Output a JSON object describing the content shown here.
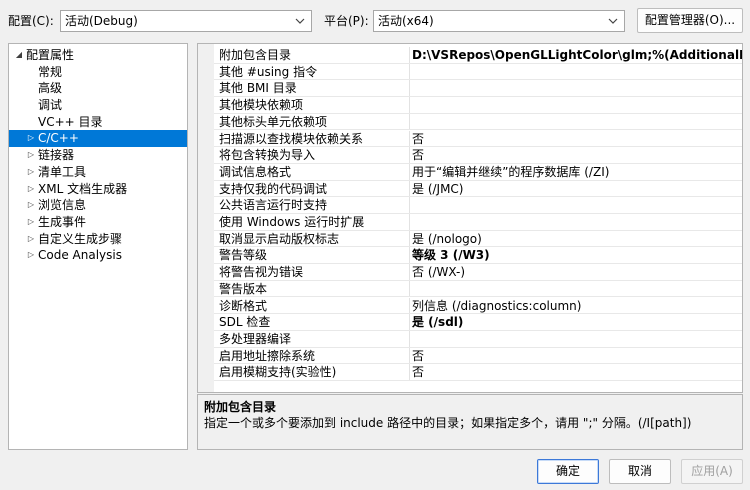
{
  "toolbar": {
    "config_label": "配置(C):",
    "config_value": "活动(Debug)",
    "platform_label": "平台(P):",
    "platform_value": "活动(x64)",
    "config_manager": "配置管理器(O)..."
  },
  "tree": {
    "items": [
      {
        "label": "配置属性",
        "twisty": "◢",
        "level": 0
      },
      {
        "label": "常规",
        "twisty": "",
        "level": 1
      },
      {
        "label": "高级",
        "twisty": "",
        "level": 1
      },
      {
        "label": "调试",
        "twisty": "",
        "level": 1
      },
      {
        "label": "VC++ 目录",
        "twisty": "",
        "level": 1
      },
      {
        "label": "C/C++",
        "twisty": "▷",
        "level": 1,
        "selected": true
      },
      {
        "label": "链接器",
        "twisty": "▷",
        "level": 1
      },
      {
        "label": "清单工具",
        "twisty": "▷",
        "level": 1
      },
      {
        "label": "XML 文档生成器",
        "twisty": "▷",
        "level": 1
      },
      {
        "label": "浏览信息",
        "twisty": "▷",
        "level": 1
      },
      {
        "label": "生成事件",
        "twisty": "▷",
        "level": 1
      },
      {
        "label": "自定义生成步骤",
        "twisty": "▷",
        "level": 1
      },
      {
        "label": "Code Analysis",
        "twisty": "▷",
        "level": 1
      }
    ]
  },
  "grid": {
    "rows": [
      {
        "name": "附加包含目录",
        "value": "D:\\VSRepos\\OpenGLLightColor\\glm;%(AdditionalIncludeDirectories)",
        "bold": true
      },
      {
        "name": "其他 #using 指令",
        "value": "",
        "bold": false
      },
      {
        "name": "其他 BMI 目录",
        "value": "",
        "bold": false
      },
      {
        "name": "其他模块依赖项",
        "value": "",
        "bold": false
      },
      {
        "name": "其他标头单元依赖项",
        "value": "",
        "bold": false
      },
      {
        "name": "扫描源以查找模块依赖关系",
        "value": "否",
        "bold": false
      },
      {
        "name": "将包含转换为导入",
        "value": "否",
        "bold": false
      },
      {
        "name": "调试信息格式",
        "value": "用于“编辑并继续”的程序数据库 (/ZI)",
        "bold": false
      },
      {
        "name": "支持仅我的代码调试",
        "value": "是 (/JMC)",
        "bold": false
      },
      {
        "name": "公共语言运行时支持",
        "value": "",
        "bold": false
      },
      {
        "name": "使用 Windows 运行时扩展",
        "value": "",
        "bold": false
      },
      {
        "name": "取消显示启动版权标志",
        "value": "是 (/nologo)",
        "bold": false
      },
      {
        "name": "警告等级",
        "value": "等级 3 (/W3)",
        "bold": true
      },
      {
        "name": "将警告视为错误",
        "value": "否 (/WX-)",
        "bold": false
      },
      {
        "name": "警告版本",
        "value": "",
        "bold": false
      },
      {
        "name": "诊断格式",
        "value": "列信息 (/diagnostics:column)",
        "bold": false
      },
      {
        "name": "SDL 检查",
        "value": "是 (/sdl)",
        "bold": true
      },
      {
        "name": "多处理器编译",
        "value": "",
        "bold": false
      },
      {
        "name": "启用地址擦除系统",
        "value": "否",
        "bold": false
      },
      {
        "name": "启用模糊支持(实验性)",
        "value": "否",
        "bold": false
      }
    ]
  },
  "description": {
    "title": "附加包含目录",
    "text": "指定一个或多个要添加到 include 路径中的目录；如果指定多个，请用 \";\" 分隔。(/I[path])"
  },
  "buttons": {
    "ok": "确定",
    "cancel": "取消",
    "apply": "应用(A)"
  },
  "icons": {
    "dropdown": "chevron-down-icon",
    "expanded": "expanded-triangle-icon",
    "collapsed": "collapsed-triangle-icon"
  }
}
